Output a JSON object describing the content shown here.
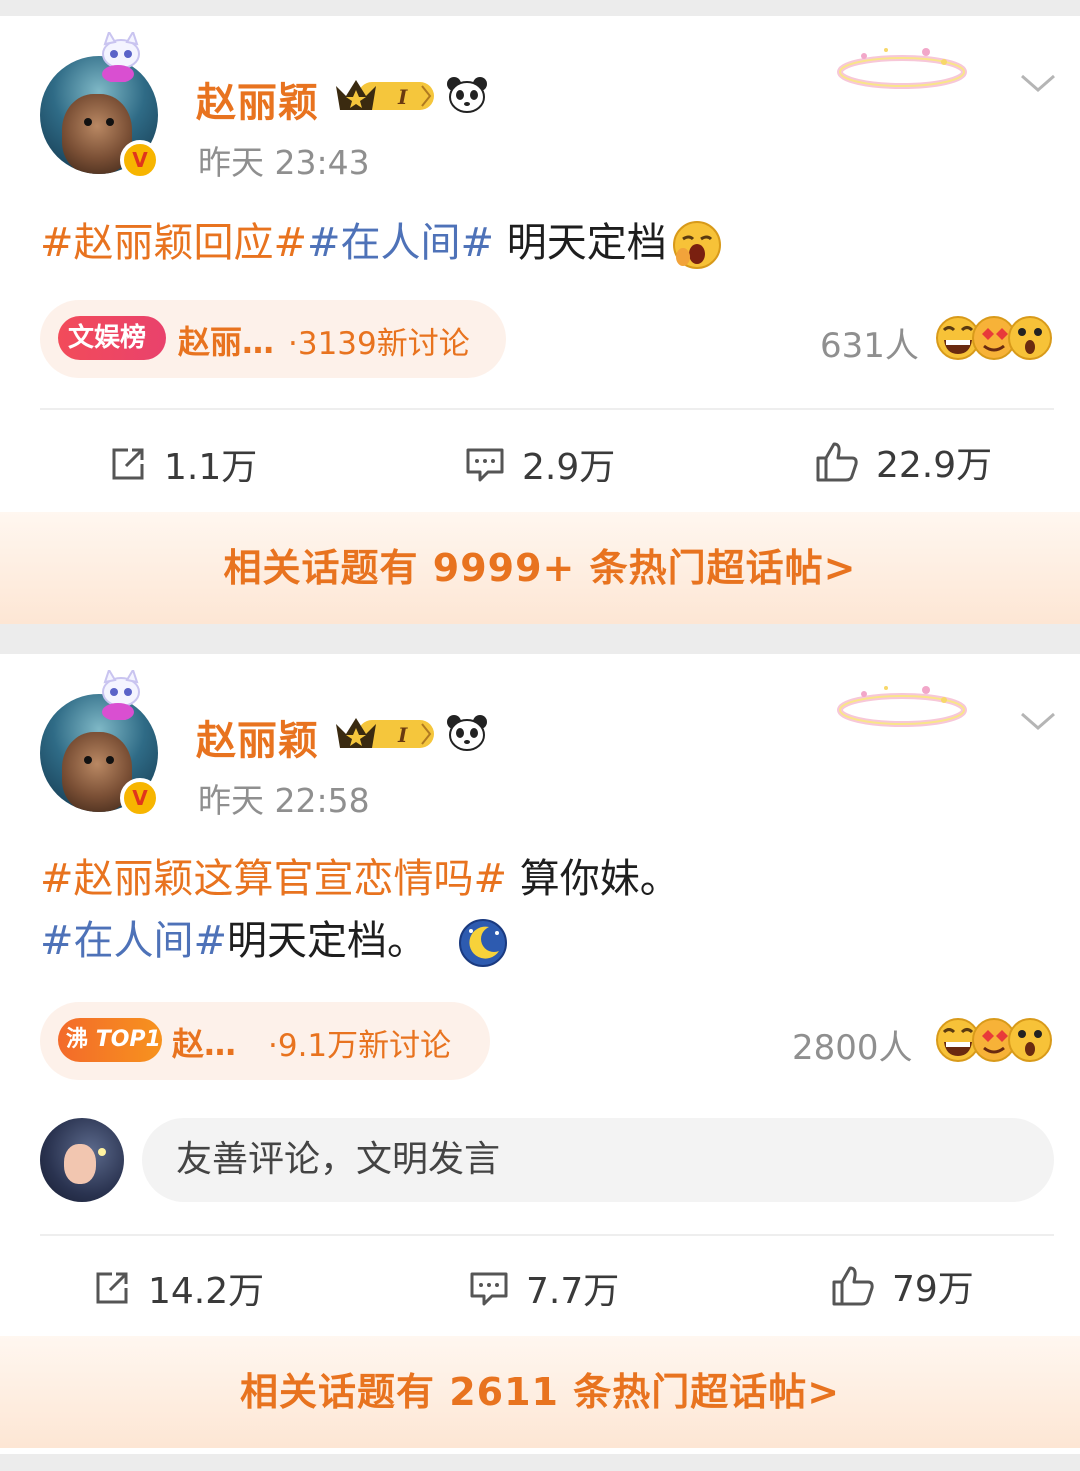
{
  "posts": [
    {
      "author": "赵丽颖",
      "badge_level": "I",
      "time": "昨天 23:43",
      "content": {
        "line1": [
          {
            "text": "#赵丽颖回应#",
            "kind": "topic-orange"
          },
          {
            "text": "#在人间#",
            "kind": "topic-blue"
          },
          {
            "text": " 明天定档",
            "kind": "plain"
          }
        ]
      },
      "topic_card": {
        "label": "文娱榜",
        "topic": "赵丽…",
        "count": "·3139新讨论"
      },
      "reactions_count": "631人",
      "actions": {
        "repost": "1.1万",
        "comment": "2.9万",
        "like": "22.9万"
      },
      "hot_banner": "相关话题有 9999+ 条热门超话帖>"
    },
    {
      "author": "赵丽颖",
      "badge_level": "I",
      "time": "昨天 22:58",
      "content": {
        "line1": [
          {
            "text": "#赵丽颖这算官宣恋情吗#",
            "kind": "topic-orange"
          },
          {
            "text": " 算你妹。",
            "kind": "plain"
          }
        ],
        "line2": [
          {
            "text": "#在人间#",
            "kind": "topic-blue"
          },
          {
            "text": "明天定档。",
            "kind": "plain"
          }
        ]
      },
      "topic_card": {
        "label": "沸",
        "label2": "TOP1",
        "topic": "赵…",
        "count": "·9.1万新讨论"
      },
      "reactions_count": "2800人",
      "comment_placeholder": "友善评论，文明发言",
      "actions": {
        "repost": "14.2万",
        "comment": "7.7万",
        "like": "79万"
      },
      "hot_banner": "相关话题有 2611 条热门超话帖>"
    }
  ],
  "colors": {
    "accent": "#e8731f",
    "topic_blue": "#4e72b8",
    "muted": "#8f8f8f"
  },
  "icons": [
    "avatar-cat-deco",
    "verified-v-badge",
    "crown-level-badge",
    "panda-icon",
    "sparkle-ring-decoration",
    "chevron-down-icon",
    "yawn-emoji",
    "moon-emoji",
    "laugh-emoji",
    "love-emoji",
    "surprise-emoji",
    "repost-icon",
    "comment-icon",
    "like-icon"
  ]
}
